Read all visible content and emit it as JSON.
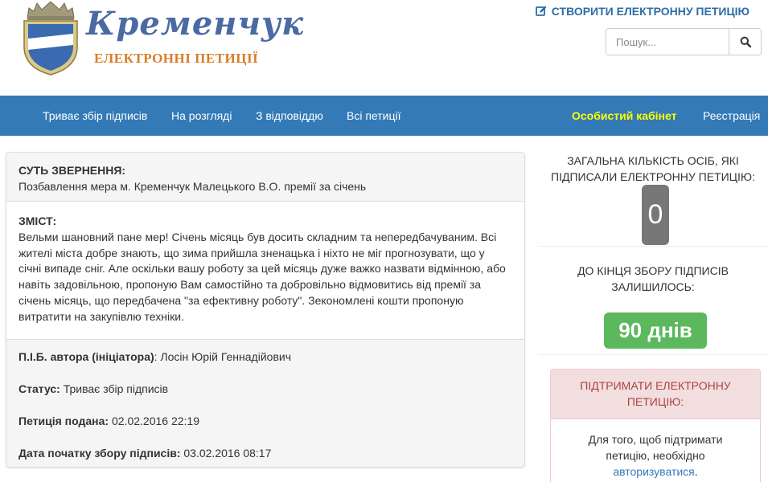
{
  "header": {
    "logo_title": "Кременчук",
    "logo_subtitle": "ЕЛЕКТРОННІ ПЕТИЦІЇ",
    "create_petition": "СТВОРИТИ ЕЛЕКТРОННУ ПЕТИЦІЮ",
    "search_placeholder": "Пошук..."
  },
  "nav": {
    "items": [
      "Триває збір підписів",
      "На розгляді",
      "З відповіддю",
      "Всі петиції"
    ],
    "cabinet": "Особистий кабінет",
    "register": "Реєстрація"
  },
  "petition": {
    "essence_label": "СУТЬ ЗВЕРНЕННЯ:",
    "essence": "Позбавлення мера м. Кременчук Малецького В.О. премії за січень",
    "content_label": "ЗМІСТ:",
    "content_lines": [
      "Вельми шановний пане мер! Січень місяць був досить складним та непередбачуваним. Всі",
      "жителі міста добре знають, що зима прийшла зненацька і ніхто не міг прогнозувати, що у",
      "січні випаде сніг. Але оскільки вашу роботу за цей місяць дуже важко назвати відмінною, або",
      "навіть задовільною, пропоную Вам самостійно та добровільно відмовитись від премії за",
      "січень місяць, що передбачена \"за ефективну роботу\". Зекономлені кошти пропоную",
      "витратити на закупівлю техніки."
    ],
    "author_label": "П.І.Б. автора (ініціатора)",
    "author": ": Лосін Юрій Геннадійович",
    "status_label": "Статус:",
    "status": " Триває збір підписів",
    "submitted_label": "Петиція подана:",
    "submitted": " 02.02.2016 22:19",
    "start_label": "Дата початку збору підписів:",
    "start": " 03.02.2016 08:17"
  },
  "stats": {
    "total_line1": "ЗАГАЛЬНА КІЛЬКІСТЬ ОСІБ, ЯКІ",
    "total_line2": "ПІДПИСАЛИ ЕЛЕКТРОННУ ПЕТИЦІЮ:",
    "count": "0",
    "remaining_line1": "ДО КІНЦЯ ЗБОРУ ПІДПИСІВ",
    "remaining_line2": "ЗАЛИШИЛОСЬ:",
    "days": "90 днів"
  },
  "support": {
    "title_line1": "ПІДТРИМАТИ ЕЛЕКТРОННУ",
    "title_line2": "ПЕТИЦІЮ:",
    "text_line1": "Для того, щоб підтримати",
    "text_line2": "петицію, необхідно",
    "link": "авторизуватися",
    "dot": "."
  },
  "colors": {
    "nav_bg": "#337ab7",
    "nav_highlight": "#ffff00",
    "days_badge": "#5cb85c",
    "count_badge": "#777777",
    "support_header_bg": "#f2dede",
    "support_header_text": "#a94442"
  }
}
